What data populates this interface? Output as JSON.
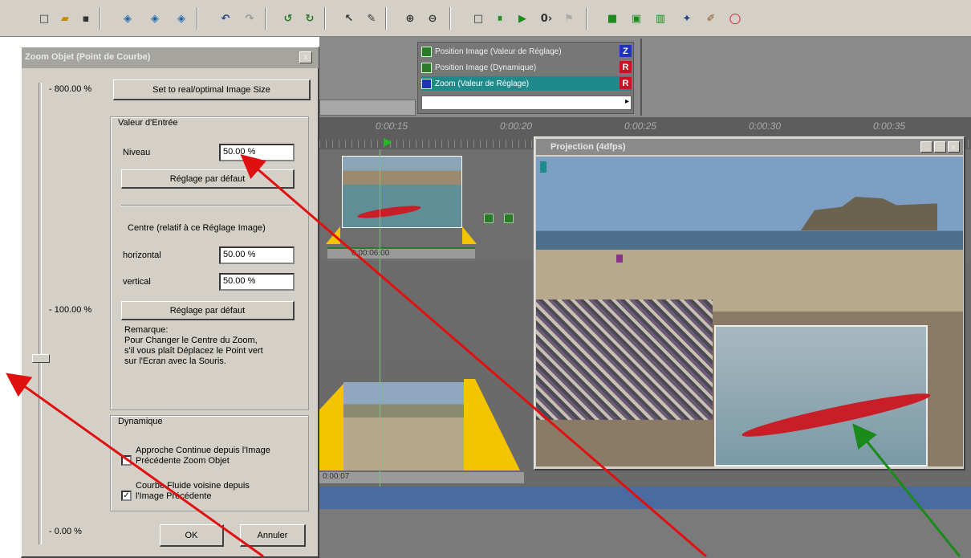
{
  "dialog": {
    "title": "Zoom Objet (Point de Courbe)",
    "close_label": "x",
    "scale": {
      "top": "- 800.00 %",
      "mid": "- 100.00 %",
      "bottom": "- 0.00 %"
    },
    "set_size_button": "Set to real/optimal Image Size",
    "input_group": {
      "title": "Valeur d'Entrée",
      "niveau_label": "Niveau",
      "niveau_value": "50.00 %",
      "default_button": "Réglage par défaut"
    },
    "center_group": {
      "title": "Centre (relatif à ce Réglage Image)",
      "horizontal_label": "horizontal",
      "horizontal_value": "50.00 %",
      "vertical_label": "vertical",
      "vertical_value": "50.00 %",
      "default_button": "Réglage par défaut",
      "note_lines": [
        "Remarque:",
        "Pour Changer le Centre du Zoom,",
        "s'il vous plaît Déplacez le Point vert",
        "sur l'Ecran avec la Souris."
      ]
    },
    "dynamic_group": {
      "title": "Dynamique",
      "option1": [
        "Approche Continue depuis l'Image",
        "Précédente Zoom Objet"
      ],
      "option1_checked": false,
      "option2": [
        "Courbe Fluide voisine depuis",
        "l'Image Précédente"
      ],
      "option2_checked": true
    },
    "ok_button": "OK",
    "cancel_button": "Annuler"
  },
  "effects": {
    "items": [
      {
        "label": "Position Image (Valeur de Réglage)",
        "badge": "Z",
        "badge_color": "#2233bb"
      },
      {
        "label": "Position Image (Dynamique)",
        "badge": "R",
        "badge_color": "#cc1122"
      },
      {
        "label": "Zoom (Valeur de Réglage)",
        "badge": "R",
        "badge_color": "#cc1122"
      }
    ],
    "selected_index": 2
  },
  "ruler": {
    "ticks": [
      "0:00:15",
      "0:00:20",
      "0:00:25",
      "0:00:30",
      "0:00:35"
    ]
  },
  "timeline": {
    "clip1_time": "0:00:06:00",
    "clip2_time": "0:00:07"
  },
  "projection": {
    "title": "Projection (4dfps)",
    "min_label": "_",
    "max_label": "□",
    "close_label": "x"
  },
  "colors": {
    "annotation_red": "#e01010",
    "annotation_green": "#1a8a1a",
    "selection": "#1e8a8a",
    "clip_yellow": "#f5c400"
  }
}
